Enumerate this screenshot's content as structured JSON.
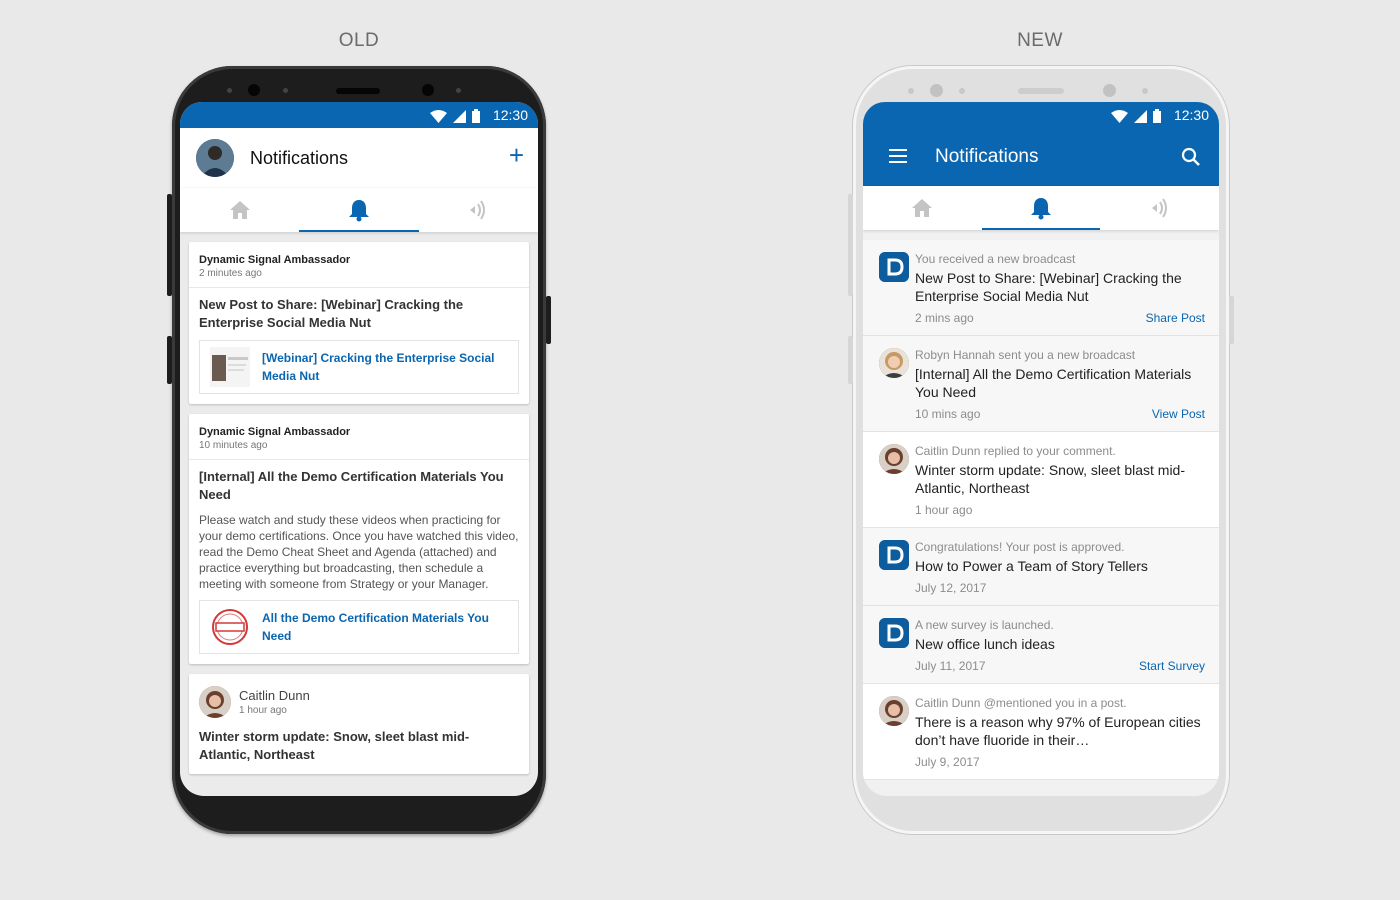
{
  "labels": {
    "old": "OLD",
    "new": "NEW"
  },
  "status_time": "12:30",
  "old": {
    "title": "Notifications",
    "plus": "+",
    "cards": [
      {
        "author": "Dynamic Signal Ambassador",
        "time": "2 minutes ago",
        "title": "New Post to Share: [Webinar] Cracking the Enterprise Social Media Nut",
        "link": "[Webinar] Cracking the Enterprise Social Media Nut"
      },
      {
        "author": "Dynamic Signal Ambassador",
        "time": "10 minutes ago",
        "title": "[Internal] All the Demo Certification Materials You Need",
        "text": "Please watch and study these videos when practicing for your demo certifications. Once you have watched this video, read the Demo Cheat Sheet and Agenda (attached) and practice everything but broadcasting, then schedule a meeting with someone from Strategy or your Manager.",
        "link": "All the Demo Certification Materials You Need"
      },
      {
        "author": "Caitlin Dunn",
        "time": "1 hour ago",
        "title": "Winter storm update: Snow, sleet blast mid-Atlantic, Northeast"
      }
    ]
  },
  "new": {
    "title": "Notifications",
    "items": [
      {
        "meta": "You received a new broadcast",
        "title": "New Post to Share: [Webinar] Cracking the Enterprise Social Media Nut",
        "time": "2 mins ago",
        "action": "Share Post"
      },
      {
        "meta": "Robyn Hannah sent you a new broadcast",
        "title": "[Internal] All the Demo Certification Materials You Need",
        "time": "10 mins ago",
        "action": "View Post"
      },
      {
        "meta": "Caitlin Dunn replied to your comment.",
        "title": "Winter storm update: Snow, sleet blast mid-Atlantic, Northeast",
        "time": "1 hour ago",
        "action": ""
      },
      {
        "meta": "Congratulations! Your post is approved.",
        "title": "How to Power a Team of Story Tellers",
        "time": "July 12, 2017",
        "action": ""
      },
      {
        "meta": "A new survey is launched.",
        "title": "New office lunch ideas",
        "time": "July 11, 2017",
        "action": "Start Survey"
      },
      {
        "meta": "Caitlin Dunn @mentioned you in a post.",
        "title": "There is a reason why 97% of European cities don’t have fluoride in their…",
        "time": "July 9, 2017",
        "action": ""
      }
    ]
  },
  "colors": {
    "brand_blue": "#0a66b0",
    "background": "#e9e9e9"
  },
  "icons": {
    "home": "home-icon",
    "bell": "bell-icon",
    "broadcast": "broadcast-icon",
    "search": "search-icon",
    "menu": "menu-icon",
    "add": "plus-icon"
  }
}
